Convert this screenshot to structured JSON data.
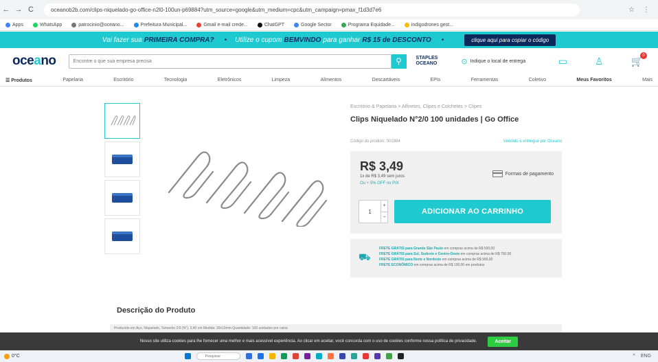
{
  "browser": {
    "url": "oceanob2b.com/clips-niquelado-go-office-n2l0-100un-p69884?utm_source=google&utm_medium=cpc&utm_campaign=pmax_f1d3d7e6",
    "back": "←",
    "forward": "→",
    "reload": "C",
    "star": "☆",
    "menu": "⋮"
  },
  "bookmarks": [
    {
      "label": "Apps",
      "color": "#4285f4"
    },
    {
      "label": "WhatsApp",
      "color": "#25d366"
    },
    {
      "label": "patrocinio@oceano...",
      "color": "#777777"
    },
    {
      "label": "Prefeitura Municipal...",
      "color": "#1e88e5"
    },
    {
      "label": "Gmail e-mail crede...",
      "color": "#ea4335"
    },
    {
      "label": "ChatGPT",
      "color": "#111111"
    },
    {
      "label": "Google Sector",
      "color": "#4285f4"
    },
    {
      "label": "Programa Equidade...",
      "color": "#34a853"
    },
    {
      "label": "indigodrones gest...",
      "color": "#fbbc05"
    }
  ],
  "promo": {
    "prefix": "Vai fazer sua",
    "first": "PRIMEIRA COMPRA?",
    "mid": "Utilize o cupom",
    "code": "BEMVINDO",
    "suffix": "para ganhar",
    "discount": "R$ 15 de DESCONTO",
    "button": "clique aqui para copiar o código"
  },
  "header": {
    "logo_a": "oce",
    "logo_b": "a",
    "logo_c": "no",
    "search_placeholder": "Encontre o que sua empresa precisa",
    "search_icon": "⚲",
    "staples_1": "STAPLES",
    "staples_2": "OCEANO",
    "location_icon": "⊙",
    "location": "Indique o local de entrega",
    "chat_icon": "▭",
    "user_icon": "♙",
    "cart_icon": "🛒",
    "cart_count": "0"
  },
  "categories": [
    "Produtos",
    "Papelaria",
    "Escritório",
    "Tecnologia",
    "Eletrônicos",
    "Limpeza",
    "Alimentos",
    "Descartáveis",
    "EPIs",
    "Ferramentas",
    "Coletivo",
    "Meus Favoritos",
    "Mais"
  ],
  "product": {
    "breadcrumb": "Escritório & Papelaria > Alfinetes, Clipes e Colchetes > Clipes",
    "title": "Clips Niquelado N°2/0 100 unidades | Go Office",
    "code": "Código do produto: 001884",
    "sold_by": "Vendido e entregue por Oceano",
    "price": "R$ 3,49",
    "installments": "1x de R$ 3,49 sem juros",
    "pix": "Ou + 5% OFF no PIX",
    "payment_label": "Formas de pagamento",
    "qty": "1",
    "qty_plus": "+",
    "qty_minus": "−",
    "add_to_cart": "ADICIONAR AO CARRINHO"
  },
  "shipping": {
    "icon": "⛟",
    "lines": [
      {
        "bold": "FRETE GRÁTIS para Grande São Paulo",
        "rest": " em compras acima de R$ 500,00"
      },
      {
        "bold": "FRETE GRÁTIS para Sul, Sudeste e Centro-Oeste",
        "rest": " em compras acima de R$ 750,00"
      },
      {
        "bold": "FRETE GRÁTIS para Norte e Nordeste",
        "rest": " em compras acima de R$ 900,00"
      },
      {
        "bold": "FRETE ECONÔMICO",
        "rest": " em compras acima de R$ 100,00 em produtos"
      }
    ]
  },
  "description": {
    "title": "Descrição do Produto",
    "text": "Produzido em Aço, Niquelado, Tamanho 2/0 (N°), 3,40 cm Medida: 30x10mm Quantidade: 100 unidades por caixa"
  },
  "cookie": {
    "text": "Nosso site utiliza cookies para lhe fornecer uma melhor e mais acessível experiência. Ao clicar em aceitar, você concorda com o uso de cookies conforme nossa política de privacidade.",
    "button": "Aceitar"
  },
  "taskbar": {
    "weather": "0°C",
    "search": "Pesquisar",
    "time": "ENG",
    "apps": [
      "#2f6fd6",
      "#1a73e8",
      "#f4b400",
      "#0f9d58",
      "#db4437",
      "#7b1fa2",
      "#00acc1",
      "#ff7043",
      "#3949ab",
      "#26a69a",
      "#e53935",
      "#5e35b1",
      "#43a047",
      "#222222"
    ]
  }
}
